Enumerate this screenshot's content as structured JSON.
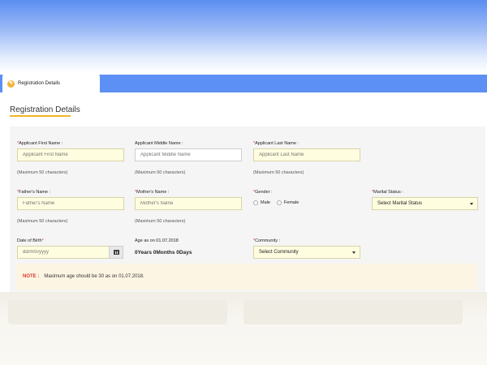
{
  "tab": {
    "icon": "registration-icon",
    "label": "Registration Details"
  },
  "section": {
    "title": "Registration Details"
  },
  "fields": {
    "first_name": {
      "label": "Applicant First Name :",
      "placeholder": "Applicant First Name",
      "hint": "(Maximum 50 characters)"
    },
    "middle_name": {
      "label": "Applicant Middle Name :",
      "placeholder": "Applicant Middle Name",
      "hint": "(Maximum 50 characters)"
    },
    "last_name": {
      "label": "Applicant Last Name :",
      "placeholder": "Applicant Last Name",
      "hint": "(Maximum 50 characters)"
    },
    "father_name": {
      "label": "Father's Name :",
      "placeholder": "Father's Name",
      "hint": "(Maximum 50 characters)"
    },
    "mother_name": {
      "label": "Mother's Name :",
      "placeholder": "Mother's Name",
      "hint": "(Maximum 50 characters)"
    },
    "gender": {
      "label": "Gender :",
      "options": [
        "Male",
        "Female"
      ]
    },
    "marital_status": {
      "label": "Marital Status :",
      "selected": "Select Marital Status"
    },
    "dob": {
      "label": "Date of Birth",
      "placeholder": "dd/mm/yyyy"
    },
    "age": {
      "label": "Age as on 01.07.2018",
      "value": "0Years  0Months  0Days"
    },
    "community": {
      "label": "Community :",
      "selected": "Select Community"
    }
  },
  "note": {
    "label": "NOTE :",
    "text": "Maximum age should be 30 as on 01.07.2018."
  },
  "colors": {
    "tabbar": "#5d90f4",
    "accent": "#f0b429",
    "required": "#e0322f",
    "input_bg": "#fffde0"
  }
}
